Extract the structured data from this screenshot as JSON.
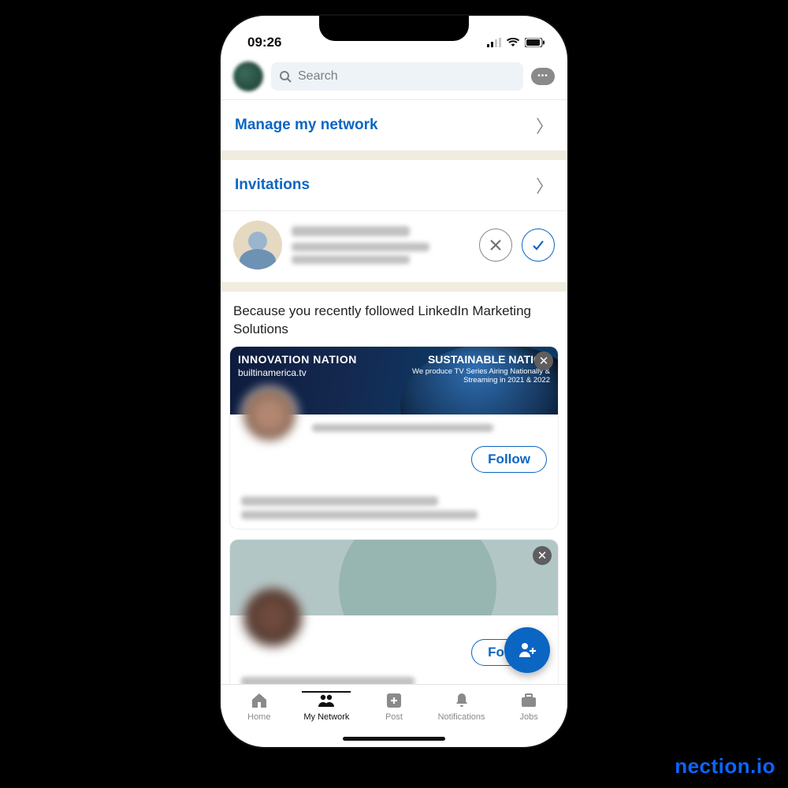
{
  "status": {
    "time": "09:26"
  },
  "search": {
    "placeholder": "Search"
  },
  "nav": {
    "manage": "Manage my network",
    "invitations": "Invitations"
  },
  "reason_text": "Because you recently followed LinkedIn Marketing Solutions",
  "suggestion": {
    "banner": {
      "title_left": "INNOVATION NATION",
      "sub_left": "builtinamerica.tv",
      "title_right": "SUSTAINABLE NATION",
      "sub_right": "We produce TV Series Airing Nationally & Streaming in 2021 & 2022"
    },
    "follow_label": "Follow"
  },
  "suggestion2": {
    "follow_label": "Follow"
  },
  "tabs": {
    "home": "Home",
    "network": "My Network",
    "post": "Post",
    "notifications": "Notifications",
    "jobs": "Jobs"
  },
  "watermark": "nection.io"
}
